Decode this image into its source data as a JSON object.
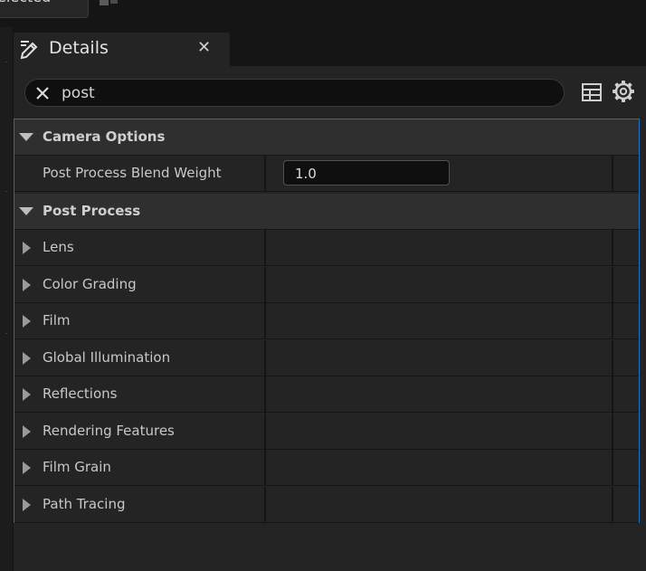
{
  "toolbar": {
    "selector_label": "elected",
    "selector_chevron": "▾"
  },
  "details": {
    "tab_title": "Details",
    "close_glyph": "✕"
  },
  "search": {
    "value": "post"
  },
  "categories": {
    "camera_options": {
      "label": "Camera Options",
      "properties": {
        "post_process_blend_weight": {
          "label": "Post Process Blend Weight",
          "value": "1.0"
        }
      }
    },
    "post_process": {
      "label": "Post Process",
      "items": [
        "Lens",
        "Color Grading",
        "Film",
        "Global Illumination",
        "Reflections",
        "Rendering Features",
        "Film Grain",
        "Path Tracing"
      ]
    }
  },
  "colors": {
    "accent_border": "#1a6fc2",
    "panel_bg": "#242424",
    "category_bg": "#2f2f2f",
    "input_bg": "#0f0f0f"
  }
}
